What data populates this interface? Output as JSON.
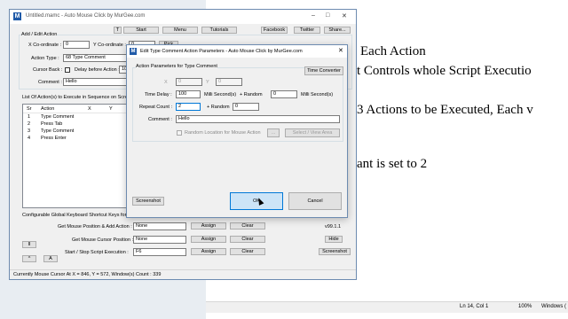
{
  "notepad": {
    "lines": [
      "Each Action",
      "t Controls whole Script Executio",
      "3 Actions to be Executed, Each v",
      "ant is set to 2"
    ],
    "status": {
      "pos": "Ln 14, Col 1",
      "zoom": "100%",
      "eol": "Windows ("
    }
  },
  "main": {
    "title": "Untitled.mamc - Auto Mouse Click by MurGee.com",
    "app_icon": "M",
    "toolbar": [
      "T",
      "Start",
      "Menu",
      "Tutorials",
      "Facebook",
      "Twitter",
      "Share..."
    ],
    "add_edit_group": "Add / Edit Action",
    "x_coord_label": "X Co-ordinate :",
    "x_coord_value": "0",
    "y_coord_label": "Y Co-ordinate :",
    "y_coord_value": "0",
    "pick_label": "Pick",
    "action_type_label": "Action Type :",
    "action_type_value": "68  Type Comment",
    "cursor_back_label": "Cursor Back :",
    "delay_before_label": "Delay before Action :",
    "delay_before_value": "10",
    "comment_label": "Comment :",
    "comment_value": "Hello",
    "list_label": "List Of Action(s) to Execute in Sequence on Screen",
    "columns": [
      "Sr",
      "Action",
      "X",
      "Y"
    ],
    "rows": [
      {
        "sr": "1",
        "action": "Type Comment"
      },
      {
        "sr": "2",
        "action": "Press Tab"
      },
      {
        "sr": "3",
        "action": "Type Comment"
      },
      {
        "sr": "4",
        "action": "Press Enter"
      }
    ],
    "shortcut_label": "Configurable Global Keyboard Shortcut Keys for th",
    "shortcuts": [
      {
        "label": "Get Mouse Position & Add Action :",
        "value": "None"
      },
      {
        "label": "Get Mouse Cursor Position :",
        "value": "None"
      },
      {
        "label": "Start / Stop Script Execution :",
        "value": "F6"
      }
    ],
    "assign_label": "Assign",
    "clear_label": "Clear",
    "version": "v99.1.1",
    "hide_label": "Hide",
    "screenshot_label": "Screenshot",
    "pause_label": "II",
    "up_label": "^",
    "a_label": "A",
    "status": "Currently Mouse Cursor At X = 846, Y = 572, Window(s) Count : 339"
  },
  "dialog": {
    "title": "Edit Type Comment Action Parameters - Auto Mouse Click by MurGee.com",
    "app_icon": "M",
    "params_label": "Action Parameters for Type Comment",
    "time_converter": "Time Converter",
    "x_label": "X",
    "x_value": "0",
    "y_label": "Y",
    "y_value": "0",
    "time_delay_label": "Time Delay :",
    "time_delay_value": "100",
    "ms_label": "Milli Second(s)",
    "plus_random_label": "+   Random",
    "random_value": "0",
    "ms_label2": "Milli Second(s)",
    "repeat_label": "Repeat Count :",
    "repeat_value": "2",
    "plus_random2": "+ Random",
    "random2_value": "0",
    "comment_label": "Comment :",
    "comment_value": "Hello",
    "random_location": "Random Location for Mouse Action",
    "dots": "...",
    "view_area": "Select / View Area",
    "screenshot": "Screenshot",
    "ok": "OK",
    "cancel": "Cancel"
  }
}
